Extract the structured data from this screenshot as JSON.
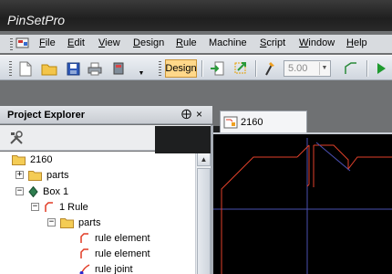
{
  "app": {
    "title": "PinSetPro"
  },
  "menu": [
    {
      "label": "File",
      "accel": "F",
      "rest": "ile"
    },
    {
      "label": "Edit",
      "accel": "E",
      "rest": "dit"
    },
    {
      "label": "View",
      "accel": "V",
      "rest": "iew"
    },
    {
      "label": "Design",
      "accel": "D",
      "rest": "esign"
    },
    {
      "label": "Rule",
      "accel": "R",
      "rest": "ule"
    },
    {
      "label": "Machine",
      "accel": "",
      "rest": "Machine"
    },
    {
      "label": "Script",
      "accel": "S",
      "rest": "cript"
    },
    {
      "label": "Window",
      "accel": "W",
      "rest": "indow"
    },
    {
      "label": "Help",
      "accel": "H",
      "rest": "elp"
    }
  ],
  "toolbar": {
    "design_label": "Design",
    "value_input": "5.00",
    "icons": [
      "new-file-icon",
      "open-folder-icon",
      "save-icon",
      "print-icon",
      "tool-icon",
      "import-icon",
      "export-icon",
      "pin-icon",
      "line-tool-icon",
      "play-icon"
    ]
  },
  "project_explorer": {
    "title": "Project Explorer",
    "pin_glyph": "⨁",
    "close_glyph": "×",
    "tree": [
      {
        "label": "2160",
        "level": 0,
        "icon": "folder-icon",
        "expander": ""
      },
      {
        "label": "parts",
        "level": 1,
        "icon": "folder-icon",
        "expander": "+"
      },
      {
        "label": "Box 1",
        "level": 1,
        "icon": "box-icon",
        "expander": "−"
      },
      {
        "label": "1 Rule",
        "level": 2,
        "icon": "rule-icon",
        "expander": "−"
      },
      {
        "label": "parts",
        "level": 3,
        "icon": "folder-icon",
        "expander": "−"
      },
      {
        "label": "rule element",
        "level": 4,
        "icon": "rule-element-icon",
        "expander": ""
      },
      {
        "label": "rule element",
        "level": 4,
        "icon": "rule-element-icon",
        "expander": ""
      },
      {
        "label": "rule joint",
        "level": 4,
        "icon": "rule-joint-icon",
        "expander": ""
      }
    ]
  },
  "document": {
    "tab_label": "2160"
  },
  "colors": {
    "canvas": "#000000",
    "rule_line": "#e0402a",
    "guide_line": "#4a4fb0",
    "design_accent": "#ffd88a"
  }
}
